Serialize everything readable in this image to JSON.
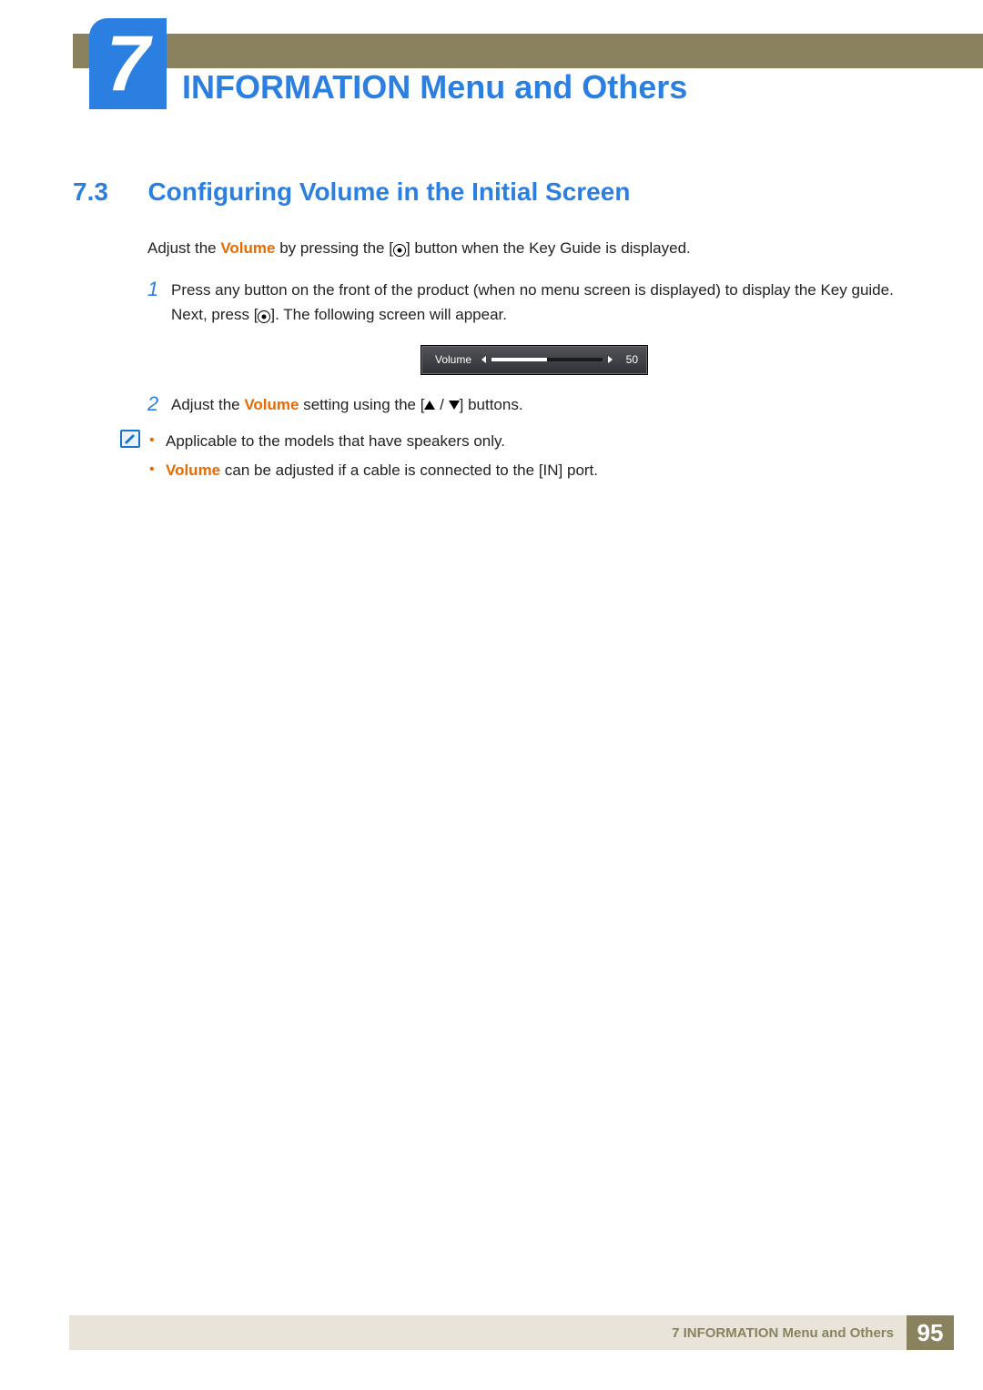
{
  "chapter": {
    "number": "7",
    "title": "INFORMATION Menu and Others"
  },
  "section": {
    "number": "7.3",
    "title": "Configuring Volume in the Initial Screen"
  },
  "intro": {
    "pre": "Adjust the ",
    "bold": "Volume",
    "post_a": " by pressing the [",
    "post_b": "] button when the Key Guide is displayed."
  },
  "step1": {
    "num": "1",
    "text_a": "Press any button on the front of the product (when no menu screen is displayed) to display the Key guide. Next, press [",
    "text_b": "]. The following screen will appear."
  },
  "osd": {
    "label": "Volume",
    "value": "50"
  },
  "step2": {
    "num": "2",
    "text_a": "Adjust the ",
    "bold": "Volume",
    "text_b": " setting using the [",
    "text_c": "] buttons."
  },
  "notes": {
    "item1": "Applicable to the models that have speakers only.",
    "item2_bold": "Volume",
    "item2_rest": " can be adjusted if a cable is connected to the [IN] port."
  },
  "footer": {
    "text": "7 INFORMATION Menu and Others",
    "page": "95"
  }
}
